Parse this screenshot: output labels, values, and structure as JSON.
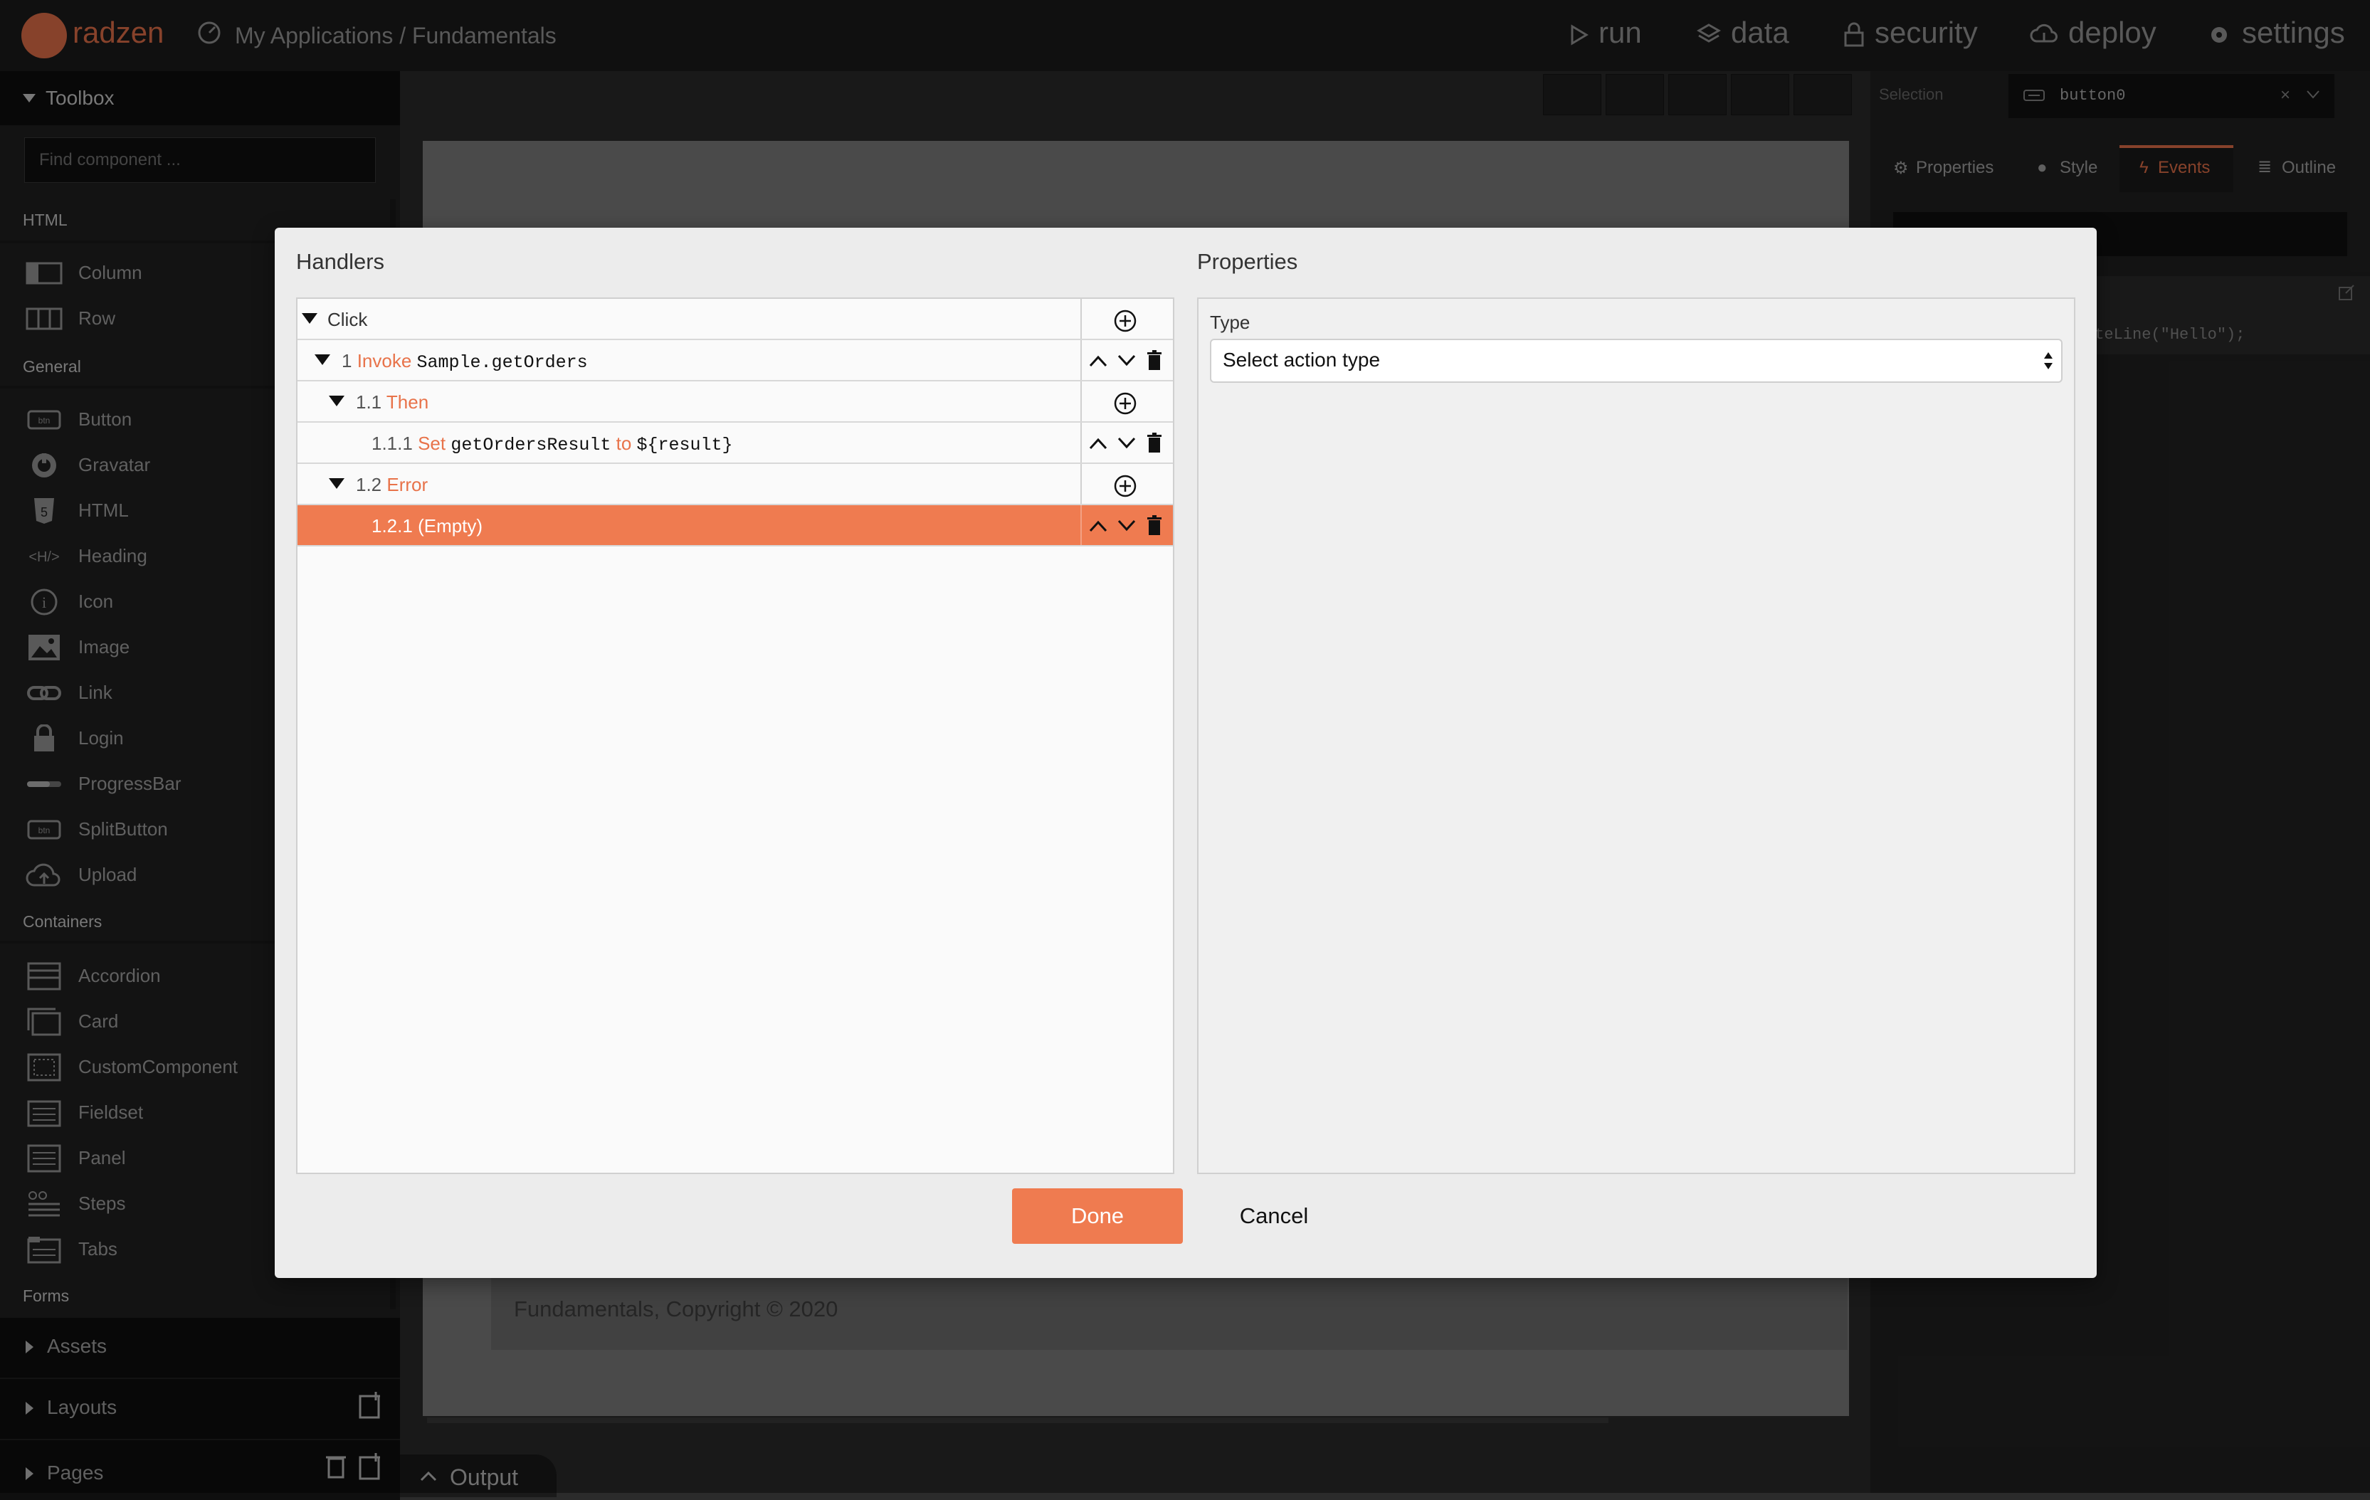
{
  "app": {
    "logo_text": "radzen",
    "breadcrumb": "My Applications / Fundamentals",
    "nav": [
      "run",
      "data",
      "security",
      "deploy",
      "settings"
    ]
  },
  "toolbox": {
    "title": "Toolbox",
    "search_placeholder": "Find component ...",
    "sections": {
      "html": "HTML",
      "general": "General",
      "containers": "Containers",
      "forms": "Forms"
    },
    "html_items": [
      "Column",
      "Row"
    ],
    "general_items": [
      "Button",
      "Gravatar",
      "HTML",
      "Heading",
      "Icon",
      "Image",
      "Link",
      "Login",
      "ProgressBar",
      "SplitButton",
      "Upload"
    ],
    "container_items": [
      "Accordion",
      "Card",
      "CustomComponent",
      "Fieldset",
      "Panel",
      "Steps",
      "Tabs"
    ],
    "bottom_panels": [
      "Assets",
      "Layouts",
      "Pages"
    ]
  },
  "canvas": {
    "footer_text": "Fundamentals, Copyright © 2020",
    "output_tab": "Output"
  },
  "inspector": {
    "selection_label": "Selection",
    "selection_value": "button0",
    "tabs": [
      "Properties",
      "Style",
      "Events",
      "Outline"
    ],
    "active_tab": "Events",
    "code_snippet": "iteLine(\"Hello\");"
  },
  "dialog": {
    "handlers_title": "Handlers",
    "properties_title": "Properties",
    "rows": [
      {
        "num": "",
        "keyword": "",
        "text": "Click",
        "code": "",
        "extra_kw": "",
        "extra_code": ""
      },
      {
        "num": "1",
        "keyword": "Invoke",
        "text": "",
        "code": "Sample.getOrders",
        "extra_kw": "",
        "extra_code": ""
      },
      {
        "num": "1.1",
        "keyword": "Then",
        "text": "",
        "code": "",
        "extra_kw": "",
        "extra_code": ""
      },
      {
        "num": "1.1.1",
        "keyword": "Set",
        "text": "",
        "code": "getOrdersResult",
        "extra_kw": "to",
        "extra_code": "${result}"
      },
      {
        "num": "1.2",
        "keyword": "Error",
        "text": "",
        "code": "",
        "extra_kw": "",
        "extra_code": ""
      },
      {
        "num": "1.2.1",
        "keyword": "",
        "text": "(Empty)",
        "code": "",
        "extra_kw": "",
        "extra_code": ""
      }
    ],
    "type_label": "Type",
    "type_value": "Select action type",
    "done_label": "Done",
    "cancel_label": "Cancel"
  },
  "colors": {
    "accent": "#e8734a",
    "selected_row": "#ef7b50"
  }
}
